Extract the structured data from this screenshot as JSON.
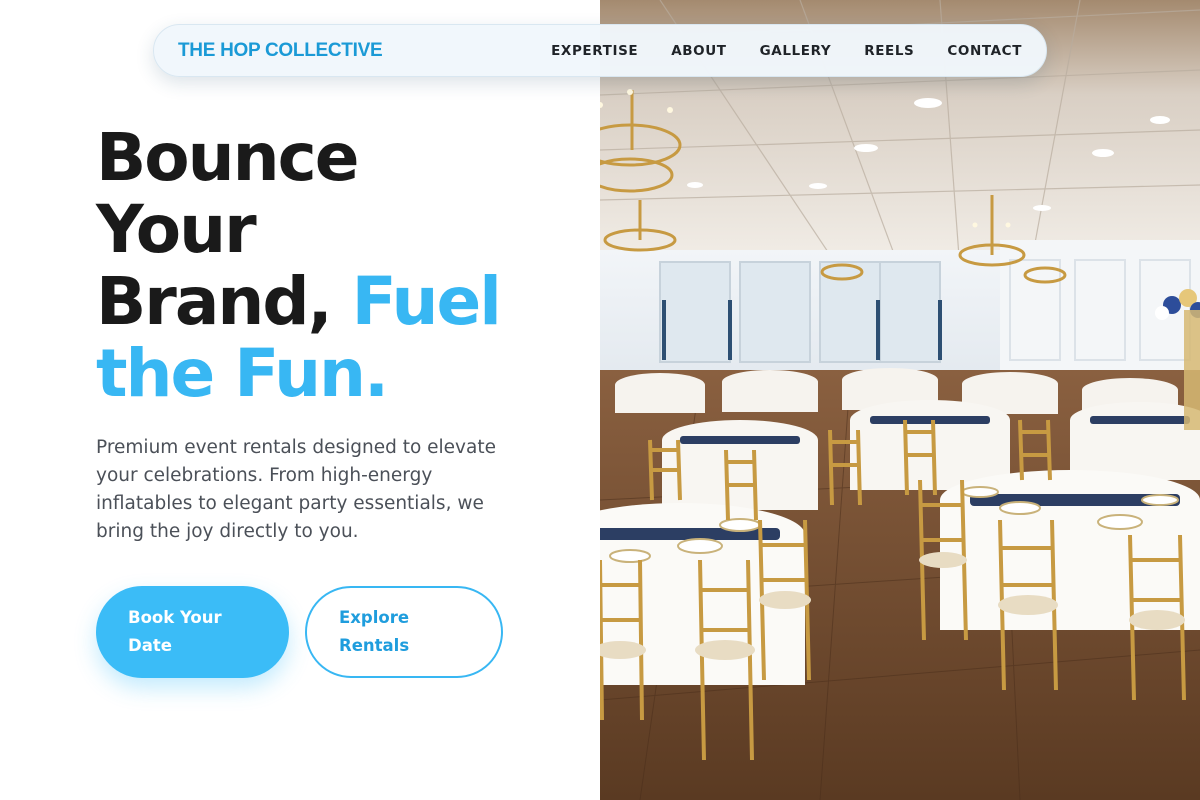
{
  "nav": {
    "brand": "THE HOP COLLECTIVE",
    "links": [
      "EXPERTISE",
      "ABOUT",
      "GALLERY",
      "REELS",
      "CONTACT"
    ]
  },
  "hero": {
    "headline_line1": "Bounce",
    "headline_line2": "Your",
    "headline_line3_dark": "Brand, ",
    "headline_line3_accent": "Fuel",
    "headline_line4_accent": "the Fun.",
    "subcopy": "Premium event rentals designed to elevate your celebrations. From high-energy inflatables to elegant party essentials, we bring the joy directly to you.",
    "primary_cta": "Book Your Date",
    "secondary_cta": "Explore Rentals"
  },
  "colors": {
    "accent": "#38b7f3",
    "brand": "#1b9ad6",
    "text_dark": "#1a1a1a",
    "text_body": "#4b5058"
  },
  "icons": {
    "photo": "banquet-hall-photo"
  }
}
